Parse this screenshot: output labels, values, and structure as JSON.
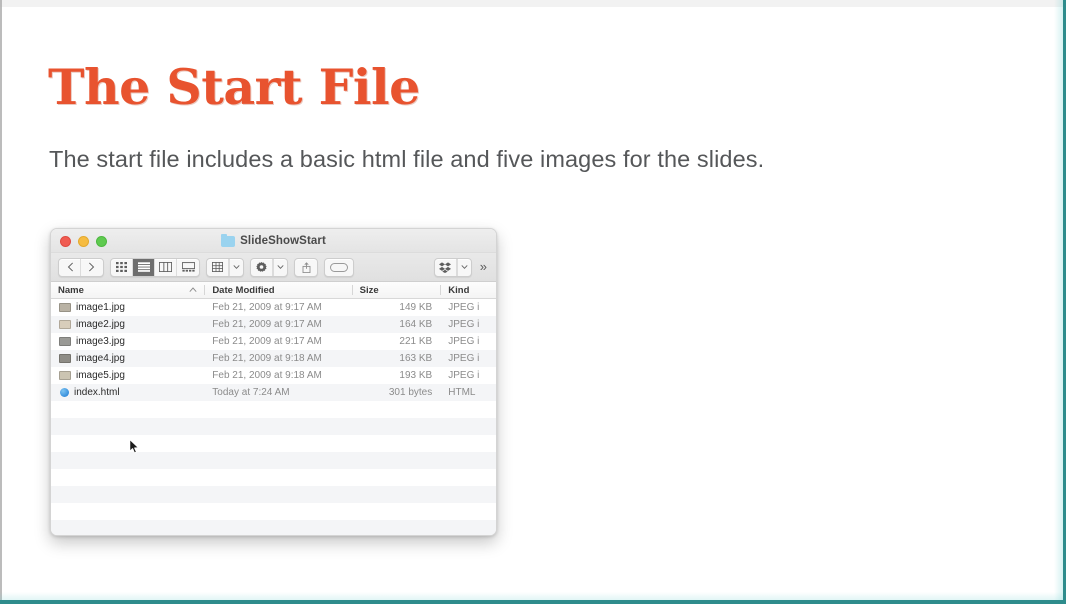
{
  "slide": {
    "title": "The Start File",
    "subtitle": "The start file includes a basic html file and five images for the slides.",
    "title_color": "#E8532F",
    "subtitle_color": "#555759",
    "border_accent_color": "#2E8C8C"
  },
  "finder": {
    "window_title": "SlideShowStart",
    "folder_icon": "folder-icon",
    "traffic_lights": [
      {
        "name": "close",
        "color": "#F05C52"
      },
      {
        "name": "minimize",
        "color": "#F6BC41"
      },
      {
        "name": "zoom",
        "color": "#5FCA50"
      }
    ],
    "toolbar": {
      "nav": [
        {
          "name": "back-button",
          "icon": "chevron-left-icon"
        },
        {
          "name": "forward-button",
          "icon": "chevron-right-icon"
        }
      ],
      "view_modes": [
        {
          "name": "icon-view-button",
          "icon": "grid-icon",
          "selected": false
        },
        {
          "name": "list-view-button",
          "icon": "list-icon",
          "selected": true
        },
        {
          "name": "column-view-button",
          "icon": "columns-icon",
          "selected": false
        },
        {
          "name": "gallery-view-button",
          "icon": "gallery-icon",
          "selected": false
        }
      ],
      "group_button": {
        "name": "group-by-button",
        "icon": "group-icon",
        "has_chevron": true
      },
      "action_button": {
        "name": "action-menu-button",
        "icon": "gear-icon",
        "has_chevron": true
      },
      "share_button": {
        "name": "share-button",
        "icon": "share-icon"
      },
      "tag_button": {
        "name": "tag-button",
        "icon": "tag-icon"
      },
      "dropbox_button": {
        "name": "dropbox-button",
        "icon": "dropbox-icon",
        "has_chevron": true
      },
      "overflow_label": "»"
    },
    "columns": [
      {
        "key": "name",
        "label": "Name",
        "sorted": true,
        "sort_icon": "chevron-up-icon"
      },
      {
        "key": "date",
        "label": "Date Modified",
        "sorted": false
      },
      {
        "key": "size",
        "label": "Size",
        "sorted": false
      },
      {
        "key": "kind",
        "label": "Kind",
        "sorted": false
      }
    ],
    "files": [
      {
        "name": "image1.jpg",
        "date": "Feb 21, 2009 at 9:17 AM",
        "size": "149 KB",
        "kind": "JPEG i",
        "icon": "image-thumbnail",
        "thumb_color": "#b9b2a4"
      },
      {
        "name": "image2.jpg",
        "date": "Feb 21, 2009 at 9:17 AM",
        "size": "164 KB",
        "kind": "JPEG i",
        "icon": "image-thumbnail",
        "thumb_color": "#d8cdbb"
      },
      {
        "name": "image3.jpg",
        "date": "Feb 21, 2009 at 9:17 AM",
        "size": "221 KB",
        "kind": "JPEG i",
        "icon": "image-thumbnail",
        "thumb_color": "#9a9a96"
      },
      {
        "name": "image4.jpg",
        "date": "Feb 21, 2009 at 9:18 AM",
        "size": "163 KB",
        "kind": "JPEG i",
        "icon": "image-thumbnail",
        "thumb_color": "#8f8d86"
      },
      {
        "name": "image5.jpg",
        "date": "Feb 21, 2009 at 9:18 AM",
        "size": "193 KB",
        "kind": "JPEG i",
        "icon": "image-thumbnail",
        "thumb_color": "#cbc4b2"
      },
      {
        "name": "index.html",
        "date": "Today at 7:24 AM",
        "size": "301 bytes",
        "kind": "HTML",
        "icon": "html-document-icon"
      }
    ],
    "empty_row_count": 8,
    "cursor": {
      "name": "mouse-cursor",
      "over_item": "image5.jpg"
    }
  }
}
